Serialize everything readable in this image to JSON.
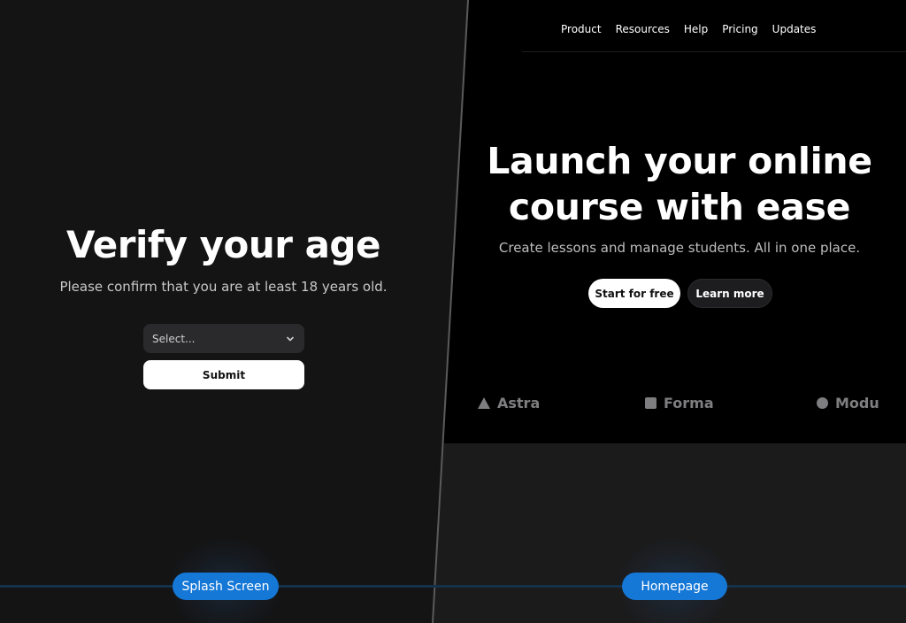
{
  "splash": {
    "title": "Verify your age",
    "subtitle": "Please confirm that you are at least 18 years old.",
    "select_placeholder": "Select...",
    "submit_label": "Submit",
    "label": "Splash Screen"
  },
  "homepage": {
    "nav": [
      "Product",
      "Resources",
      "Help",
      "Pricing",
      "Updates"
    ],
    "hero_title_line1": "Launch your online",
    "hero_title_line2": "course with ease",
    "hero_subtitle": "Create lessons and manage students. All in one place.",
    "primary_cta": "Start for free",
    "secondary_cta": "Learn more",
    "logos": [
      {
        "name": "Astra",
        "icon": "triangle-icon"
      },
      {
        "name": "Forma",
        "icon": "square-icon"
      },
      {
        "name": "Modu",
        "icon": "circle-icon"
      }
    ],
    "label": "Homepage"
  },
  "colors": {
    "accent": "#1577d6",
    "left_bg": "#141415",
    "hero_bg": "#000000",
    "lower_bg": "#1b1b1c"
  }
}
